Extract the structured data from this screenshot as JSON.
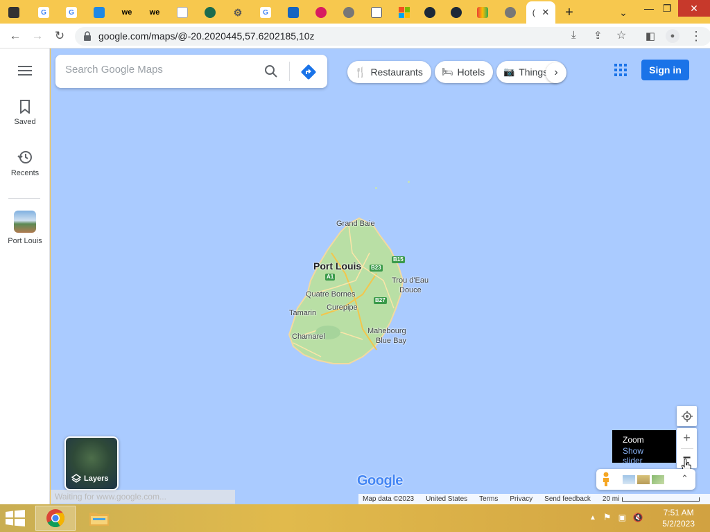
{
  "browser": {
    "active_tab_title": "(",
    "url": "google.com/maps/@-20.2020445,57.6202185,10z",
    "window_controls": {
      "minimize": "—",
      "restore": "❐",
      "close": "✕"
    }
  },
  "maps": {
    "search": {
      "placeholder": "Search Google Maps"
    },
    "rail": {
      "menu_label": "",
      "saved_label": "Saved",
      "recents_label": "Recents",
      "recent_place_label": "Port Louis"
    },
    "chips": [
      {
        "label": "Restaurants",
        "icon": "fork-knife-icon"
      },
      {
        "label": "Hotels",
        "icon": "bed-icon"
      },
      {
        "label": "Things",
        "icon": "camera-icon"
      }
    ],
    "sign_in_label": "Sign in",
    "map_labels": {
      "grand_baie": "Grand Baie",
      "port_louis": "Port Louis",
      "trou_deau_douce_1": "Trou d'Eau",
      "trou_deau_douce_2": "Douce",
      "quatre_bornes": "Quatre Bornes",
      "curepipe": "Curepipe",
      "tamarin": "Tamarin",
      "chamarel": "Chamarel",
      "mahebourg": "Mahebourg",
      "blue_bay": "Blue Bay"
    },
    "road_shields": {
      "b15": "B15",
      "b23": "B23",
      "a1": "A1",
      "b27": "B27"
    },
    "layers_label": "Layers",
    "tooltip": {
      "title": "Zoom",
      "subtitle": "Show slider"
    },
    "logo_text": "Google",
    "footer": {
      "map_data": "Map data ©2023",
      "region": "United States",
      "terms": "Terms",
      "privacy": "Privacy",
      "feedback": "Send feedback",
      "scale": "20 mi"
    },
    "status_text": "Waiting for www.google.com..."
  },
  "taskbar": {
    "time": "7:51 AM",
    "date": "5/2/2023"
  },
  "colors": {
    "map_water": "#aacbff",
    "island_green": "#b9dfa5",
    "tabstrip": "#f7c84e",
    "accent_blue": "#1a73e8",
    "road_yellow": "#f3c64c"
  }
}
